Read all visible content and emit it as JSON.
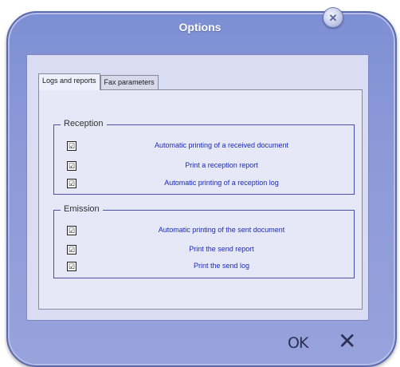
{
  "window": {
    "title": "Options",
    "close_icon": "close-icon"
  },
  "tabs": [
    {
      "label": "Logs and reports",
      "active": true
    },
    {
      "label": "Fax parameters",
      "active": false
    }
  ],
  "reception": {
    "title": "Reception",
    "items": [
      {
        "label": "Automatic printing of a received document",
        "checked": true,
        "mark": "☑"
      },
      {
        "label": "Print a reception report",
        "checked": true,
        "mark": "☑"
      },
      {
        "label": "Automatic printing of a reception log",
        "checked": true,
        "mark": "☑"
      }
    ]
  },
  "emission": {
    "title": "Emission",
    "items": [
      {
        "label": "Automatic printing of the sent document",
        "checked": true,
        "mark": "☑"
      },
      {
        "label": "Print the send report",
        "checked": true,
        "mark": "☑"
      },
      {
        "label": "Print the send log",
        "checked": true,
        "mark": "☑"
      }
    ]
  },
  "footer": {
    "ok_label": "OK",
    "cancel_icon": "cancel-x-icon",
    "cancel_glyph": "✕"
  }
}
